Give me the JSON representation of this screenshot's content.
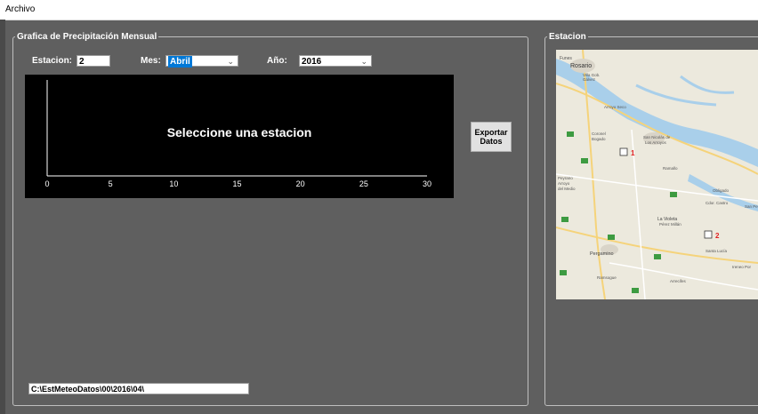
{
  "menu": {
    "file_label": "Archivo"
  },
  "group_grafica": {
    "title": "Grafica de Precipitación Mensual",
    "estacion_label": "Estacion:",
    "estacion_value": "2",
    "mes_label": "Mes:",
    "mes_value": "Abril",
    "anio_label": "Año:",
    "anio_value": "2016",
    "export_button_line1": "Exportar",
    "export_button_line2": "Datos",
    "path_value": "C:\\EstMeteoDatos\\00\\2016\\04\\"
  },
  "chart_data": {
    "type": "bar",
    "message": "Seleccione una estacion",
    "x_ticks": [
      "0",
      "5",
      "10",
      "15",
      "20",
      "25",
      "30"
    ],
    "xlim": [
      0,
      30
    ],
    "values": [],
    "background": "#000000",
    "foreground": "#ffffff"
  },
  "group_estacion": {
    "title": "Estacion",
    "map": {
      "place_labels": [
        "Funes",
        "Rosario",
        "Villa Gob. Gálvez",
        "Arroyo Seco",
        "Coronel Bogado",
        "San Nicolás de Los Arroyos",
        "Ramallo",
        "Peyrano",
        "Arroyo del Medio",
        "Obligado",
        "Cdor. Castro",
        "San Pe",
        "La Violeta",
        "Pérez Millán",
        "Santa Lucía",
        "Pergamino",
        "Ramsogue",
        "Arrecifes",
        "Ireneo Por"
      ],
      "station_markers": [
        {
          "label": "1"
        },
        {
          "label": "2"
        }
      ]
    }
  },
  "colors": {
    "window_bg": "#5f5f5f",
    "selection": "#0078d7",
    "marker": "#e02020"
  }
}
